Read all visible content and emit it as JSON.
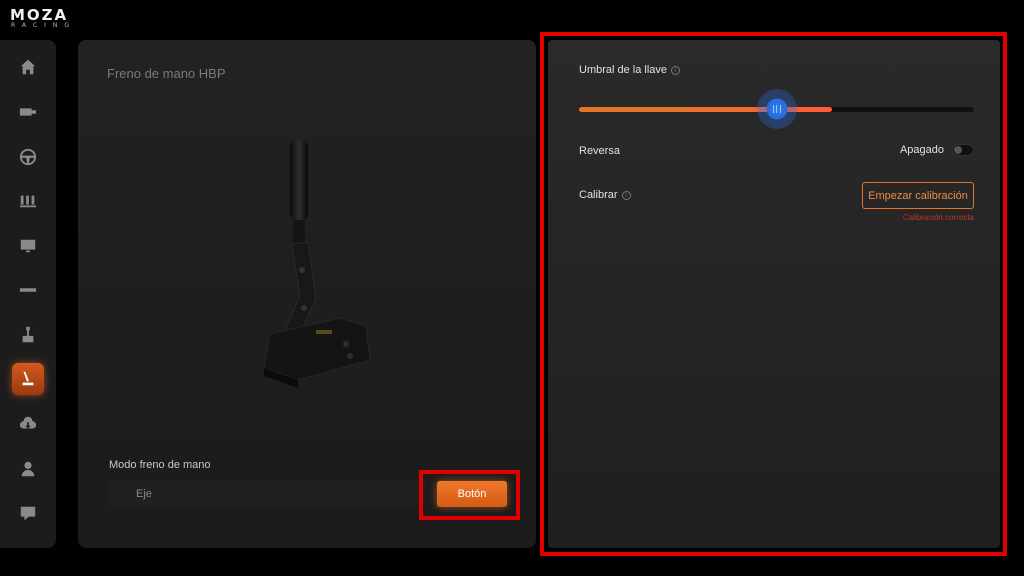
{
  "brand": {
    "name": "MOZA",
    "sub": "RACING"
  },
  "sidebar": {
    "items": [
      {
        "icon": "home-icon"
      },
      {
        "icon": "wheelbase-icon"
      },
      {
        "icon": "steering-wheel-icon"
      },
      {
        "icon": "pedals-icon"
      },
      {
        "icon": "dashboard-icon"
      },
      {
        "icon": "led-strip-icon"
      },
      {
        "icon": "shifter-icon"
      },
      {
        "icon": "handbrake-icon",
        "active": true
      },
      {
        "icon": "cloud-download-icon"
      },
      {
        "icon": "user-icon"
      },
      {
        "icon": "help-icon"
      }
    ]
  },
  "left_panel": {
    "title": "Freno de mano HBP",
    "mode_label": "Modo freno de mano",
    "mode_options": [
      "Eje",
      "Botón"
    ],
    "mode_selected": "Botón"
  },
  "right_panel": {
    "threshold_label": "Umbral de la llave",
    "threshold_fraction": 0.64,
    "thumb_fraction": 0.5,
    "reverse_label": "Reversa",
    "reverse_state": "Apagado",
    "calibrate_label": "Calibrar",
    "calibrate_button": "Empezar calibración",
    "calibrate_status": "Calibración correcta"
  },
  "colors": {
    "accent": "#e8742a",
    "highlight": "#e00000",
    "thumb": "#2a7ff2",
    "status_error": "#c0342c"
  }
}
